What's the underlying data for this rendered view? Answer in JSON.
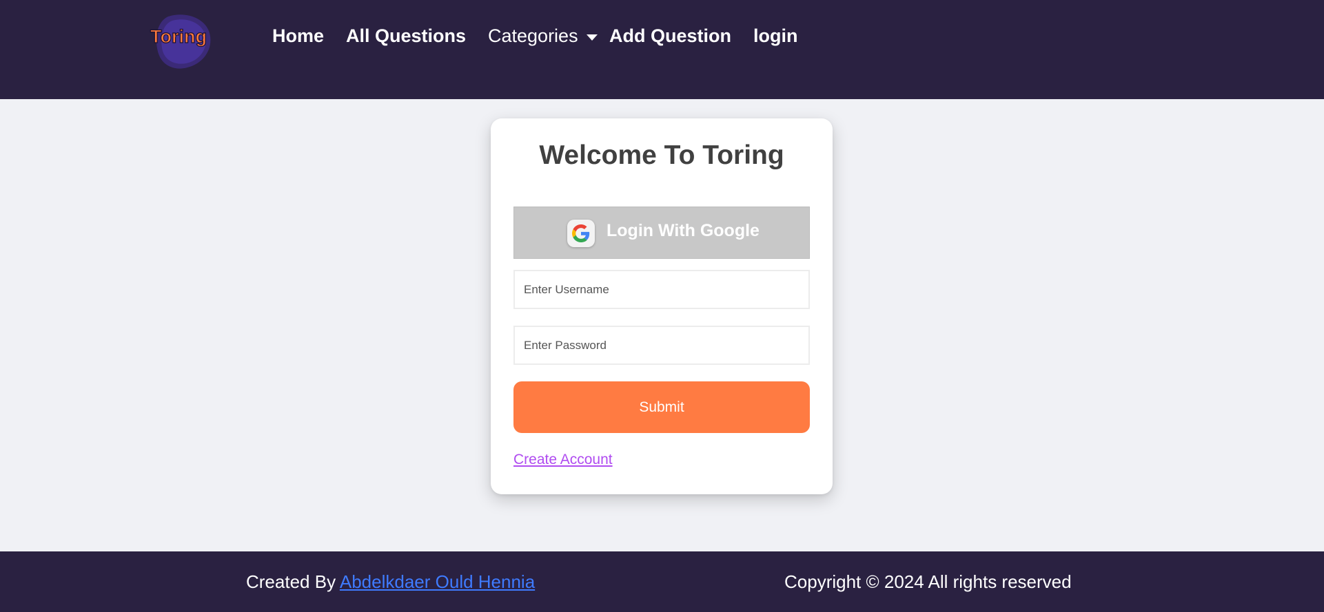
{
  "colors": {
    "navbar_bg": "#2a2141",
    "page_bg": "#f0f1f5",
    "accent_orange": "#ff7b42",
    "link_purple": "#b04cf0",
    "link_blue": "#3f7bff",
    "google_button_bg": "#c8c8c8"
  },
  "navbar": {
    "logo_text": "Toring",
    "links": {
      "home": "Home",
      "all_questions": "All Questions",
      "categories": "Categories",
      "add_question": "Add Question",
      "login": "login"
    },
    "categories_icon": "caret-down-icon"
  },
  "login_card": {
    "title": "Welcome To Toring",
    "google_button_label": "Login With Google",
    "google_icon": "google-icon",
    "username_placeholder": "Enter Username",
    "username_value": "",
    "password_placeholder": "Enter Password",
    "password_value": "",
    "submit_label": "Submit",
    "create_account_label": "Create Account"
  },
  "footer": {
    "created_by_prefix": "Created By",
    "author_name": "Abdelkdaer Ould Hennia",
    "copyright": "Copyright © 2024 All rights reserved"
  }
}
